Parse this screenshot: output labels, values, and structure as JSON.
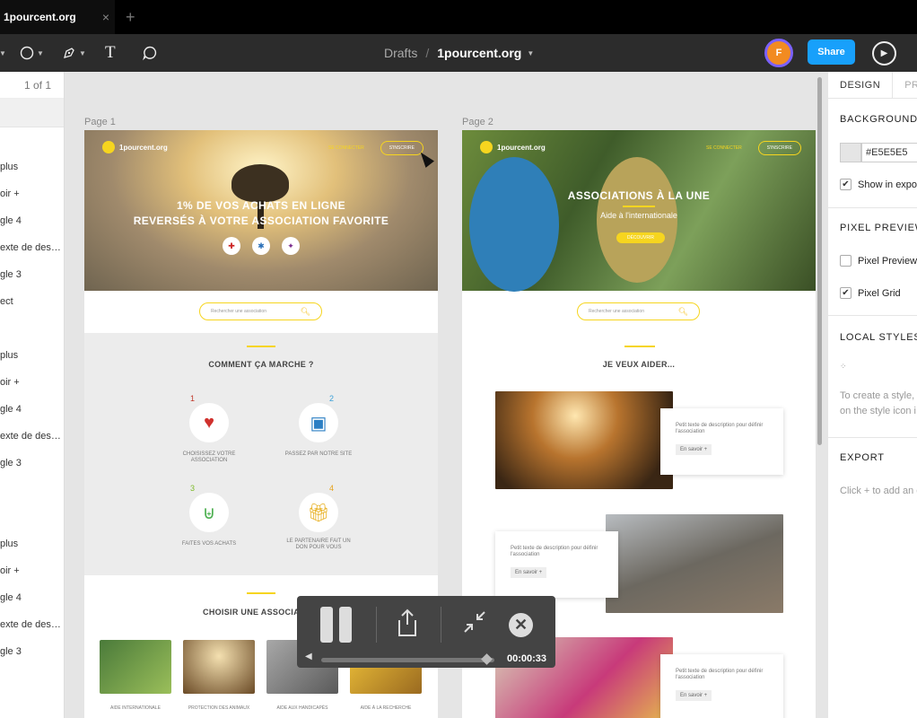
{
  "tab": {
    "title": "1pourcent.org",
    "close": "×",
    "new": "+"
  },
  "toolbar": {
    "pen_icon": "pen-icon",
    "text_tool": "T",
    "breadcrumb_drafts": "Drafts",
    "breadcrumb_sep": "/",
    "file_name": "1pourcent.org",
    "avatar_initial": "F",
    "share": "Share"
  },
  "left_panel": {
    "page_count": "1 of 1",
    "layers": [
      "plus",
      "oir +",
      "gle 4",
      "exte de des…",
      "gle 3",
      "ect",
      "",
      "plus",
      "oir +",
      "gle 4",
      "exte de des…",
      "gle 3",
      "plus",
      "oir +",
      "gle 4",
      "exte de des…",
      "gle 3"
    ]
  },
  "right_panel": {
    "tab_design": "DESIGN",
    "tab_prototype": "PR",
    "background": "BACKGROUND",
    "bg_hex": "#E5E5E5",
    "show_in_export": "Show in expor",
    "pixel_preview_title": "PIXEL PREVIEW",
    "pixel_preview": "Pixel Preview",
    "pixel_grid": "Pixel Grid",
    "local_styles": "LOCAL STYLES",
    "styles_hint_1": "To create a style, s",
    "styles_hint_2": "on the style icon i",
    "export": "EXPORT",
    "export_hint": "Click + to add an e"
  },
  "canvas": {
    "page1_label": "Page 1",
    "page2_label": "Page 2"
  },
  "page1": {
    "logo": "1pourcent.org",
    "login": "SE CONNECTER",
    "signup": "S'INSCRIRE",
    "hero_line1": "1% DE VOS ACHATS EN LIGNE",
    "hero_line2": "REVERSÉS À VOTRE ASSOCIATION FAVORITE",
    "search_placeholder": "Rechercher une association",
    "how_title": "COMMENT ÇA MARCHE ?",
    "steps": [
      {
        "num": "1",
        "caption": "CHOISISSEZ VOTRE ASSOCIATION"
      },
      {
        "num": "2",
        "caption": "PASSEZ PAR NOTRE SITE"
      },
      {
        "num": "3",
        "caption": "FAITES VOS ACHATS"
      },
      {
        "num": "4",
        "caption": "LE PARTENAIRE FAIT UN DON POUR VOUS"
      }
    ],
    "choose_title": "CHOISIR UNE ASSOCIATION",
    "categories": [
      "AIDE INTERNATIONALE",
      "PROTECTION DES ANIMAUX",
      "AIDE AUX HANDICAPÉS",
      "AIDE À LA RECHERCHE"
    ]
  },
  "page2": {
    "logo": "1pourcent.org",
    "login": "SE CONNECTER",
    "signup": "S'INSCRIRE",
    "hero_title": "ASSOCIATIONS À LA UNE",
    "hero_sub": "Aide à l'internationale",
    "hero_button": "DÉCOUVRIR",
    "search_placeholder": "Rechercher une association",
    "help_title": "JE VEUX AIDER...",
    "card_text": "Petit texte de description pour définir l'association",
    "card_button": "En savoir +"
  },
  "player": {
    "time": "00:00:33",
    "progress": 0.95
  }
}
